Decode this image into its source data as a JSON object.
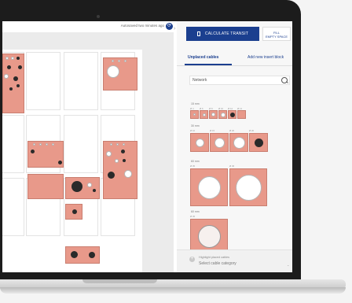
{
  "header": {
    "autosave": "Autosaved two minutes ago"
  },
  "toolbar": {
    "calculate_label": "CALCULATE TRANSIT",
    "fill_label_1": "FILL",
    "fill_label_2": "EMPTY SPACE"
  },
  "tabs": [
    {
      "label": "Unplaced cables"
    },
    {
      "label": "Add new insert block"
    }
  ],
  "search": {
    "value": "Network"
  },
  "sections": [
    {
      "label": "15 mm",
      "items": [
        "Ø 4",
        "Ø 6",
        "Ø 8",
        "Ø 10",
        "Ø 12",
        "Ø 14"
      ]
    },
    {
      "label": "30 mm",
      "items": [
        "Ø 10",
        "Ø 15",
        "Ø 20",
        "Ø 20"
      ]
    },
    {
      "label": "60 mm",
      "items": [
        "Ø 35",
        "Ø 45"
      ]
    },
    {
      "label": "60 mm",
      "items": [
        "Ø 35"
      ]
    }
  ],
  "footer": {
    "highlight_label": "Highlight placed cables",
    "category_placeholder": "Select cable category"
  },
  "colors": {
    "accent": "#1b3f8f",
    "block": "#e8998a"
  }
}
